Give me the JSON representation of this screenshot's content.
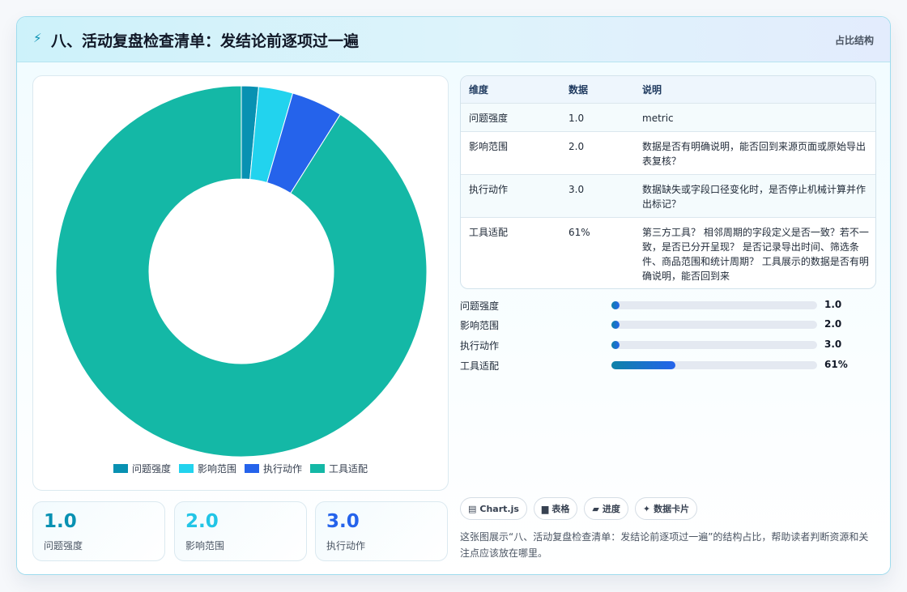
{
  "header": {
    "icon": "bolt-icon",
    "title": "八、活动复盘检查清单：发结论前逐项过一遍",
    "tag": "占比结构"
  },
  "chart_data": {
    "type": "pie",
    "donut": true,
    "categories": [
      "问题强度",
      "影响范围",
      "执行动作",
      "工具适配"
    ],
    "values": [
      1.0,
      2.0,
      3.0,
      61
    ],
    "colors": [
      "#0891b2",
      "#22d3ee",
      "#2563eb",
      "#14b8a6"
    ],
    "legend": "bottom"
  },
  "stats": [
    {
      "value": "1.0",
      "label": "问题强度",
      "color": "#0891b2"
    },
    {
      "value": "2.0",
      "label": "影响范围",
      "color": "#22c5e6"
    },
    {
      "value": "3.0",
      "label": "执行动作",
      "color": "#2563eb"
    }
  ],
  "table": {
    "headers": [
      "维度",
      "数据",
      "说明"
    ],
    "rows": [
      {
        "dim": "问题强度",
        "data": "1.0",
        "desc": "metric"
      },
      {
        "dim": "影响范围",
        "data": "2.0",
        "desc": "数据是否有明确说明，能否回到来源页面或原始导出表复核？"
      },
      {
        "dim": "执行动作",
        "data": "3.0",
        "desc": "数据缺失或字段口径变化时，是否停止机械计算并作出标记？"
      },
      {
        "dim": "工具适配",
        "data": "61%",
        "desc": "第三方工具？ 相邻周期的字段定义是否一致？若不一致，是否已分开呈现？ 是否记录导出时间、筛选条件、商品范围和统计周期？ 工具展示的数据是否有明确说明，能否回到来"
      }
    ]
  },
  "progress": [
    {
      "label": "问题强度",
      "value": "1.0",
      "fraction": 0.0
    },
    {
      "label": "影响范围",
      "value": "2.0",
      "fraction": 0.0
    },
    {
      "label": "执行动作",
      "value": "3.0",
      "fraction": 0.0
    },
    {
      "label": "工具适配",
      "value": "61%",
      "fraction": 0.31
    }
  ],
  "chips": [
    {
      "icon": "chart-icon",
      "glyph": "▤",
      "label": "Chart.js"
    },
    {
      "icon": "table-icon",
      "glyph": "▆",
      "label": "表格"
    },
    {
      "icon": "folder-icon",
      "glyph": "▰",
      "label": "进度"
    },
    {
      "icon": "sparkle-icon",
      "glyph": "✦",
      "label": "数据卡片"
    }
  ],
  "description": "这张图展示“八、活动复盘检查清单：发结论前逐项过一遍”的结构占比，帮助读者判断资源和关注点应该放在哪里。"
}
